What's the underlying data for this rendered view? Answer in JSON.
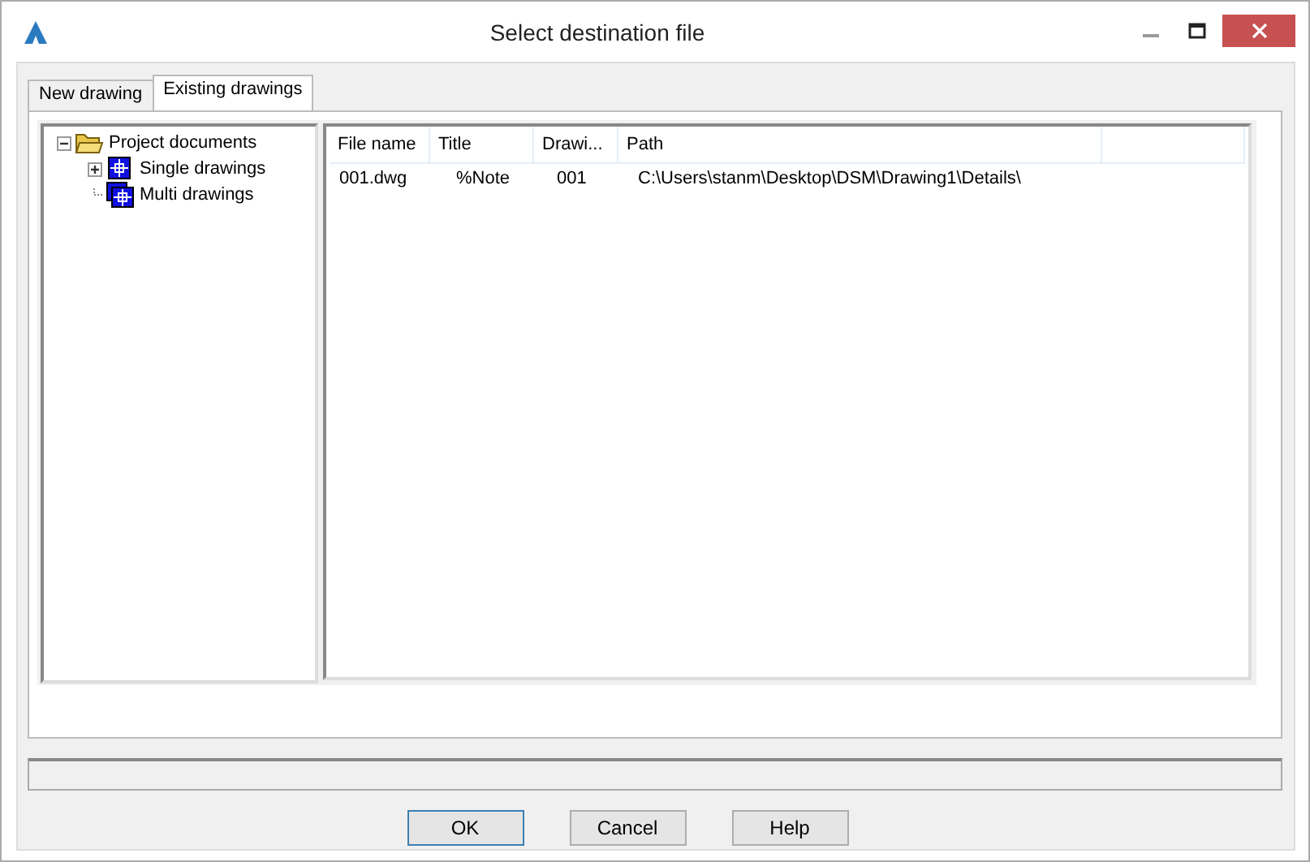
{
  "window": {
    "title": "Select destination file"
  },
  "tabs": [
    {
      "label": "New drawing",
      "selected": false
    },
    {
      "label": "Existing drawings",
      "selected": true
    }
  ],
  "tree": [
    {
      "label": "Project documents",
      "kind": "folder",
      "expanded": true,
      "children": [
        {
          "label": "Single drawings",
          "kind": "drawing",
          "expanded": false
        },
        {
          "label": "Multi drawings",
          "kind": "multi"
        }
      ]
    }
  ],
  "table": {
    "columns": [
      "File name",
      "Title",
      "Drawi...",
      "Path"
    ],
    "rows": [
      {
        "cells": [
          "001.dwg",
          "%Note",
          "001",
          "C:\\Users\\stanm\\Desktop\\DSM\\Drawing1\\Details\\"
        ],
        "selected": false
      }
    ]
  },
  "buttons": [
    {
      "label": "OK",
      "default": true
    },
    {
      "label": "Cancel",
      "default": false
    },
    {
      "label": "Help",
      "default": false
    }
  ]
}
